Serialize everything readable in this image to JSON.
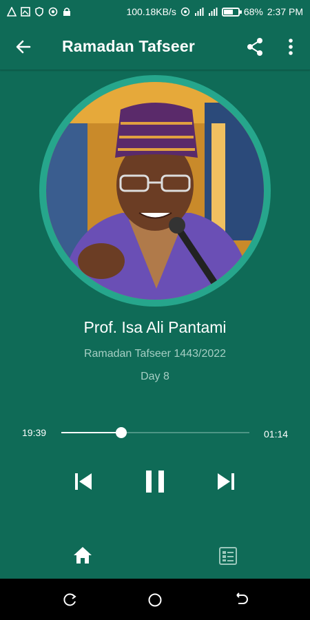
{
  "status_bar": {
    "network_speed": "100.18KB/s",
    "battery": "68%",
    "battery_level": 0.68,
    "time": "2:37 PM"
  },
  "app_bar": {
    "title": "Ramadan Tafseer",
    "back_icon": "arrow-left-icon",
    "share_icon": "share-icon",
    "more_icon": "more-vertical-icon"
  },
  "track": {
    "artist": "Prof. Isa Ali Pantami",
    "album": "Ramadan Tafseer 1443/2022",
    "episode": "Day 8"
  },
  "player": {
    "elapsed": "19:39",
    "remaining": "01:14",
    "progress": 0.32,
    "prev_icon": "skip-previous-icon",
    "pause_icon": "pause-icon",
    "next_icon": "skip-next-icon"
  },
  "bottom_nav": {
    "home_icon": "home-icon",
    "list_icon": "list-icon"
  },
  "colors": {
    "background": "#0f6b57",
    "ring": "#26a68c",
    "subtitle": "#a6cfc4"
  }
}
